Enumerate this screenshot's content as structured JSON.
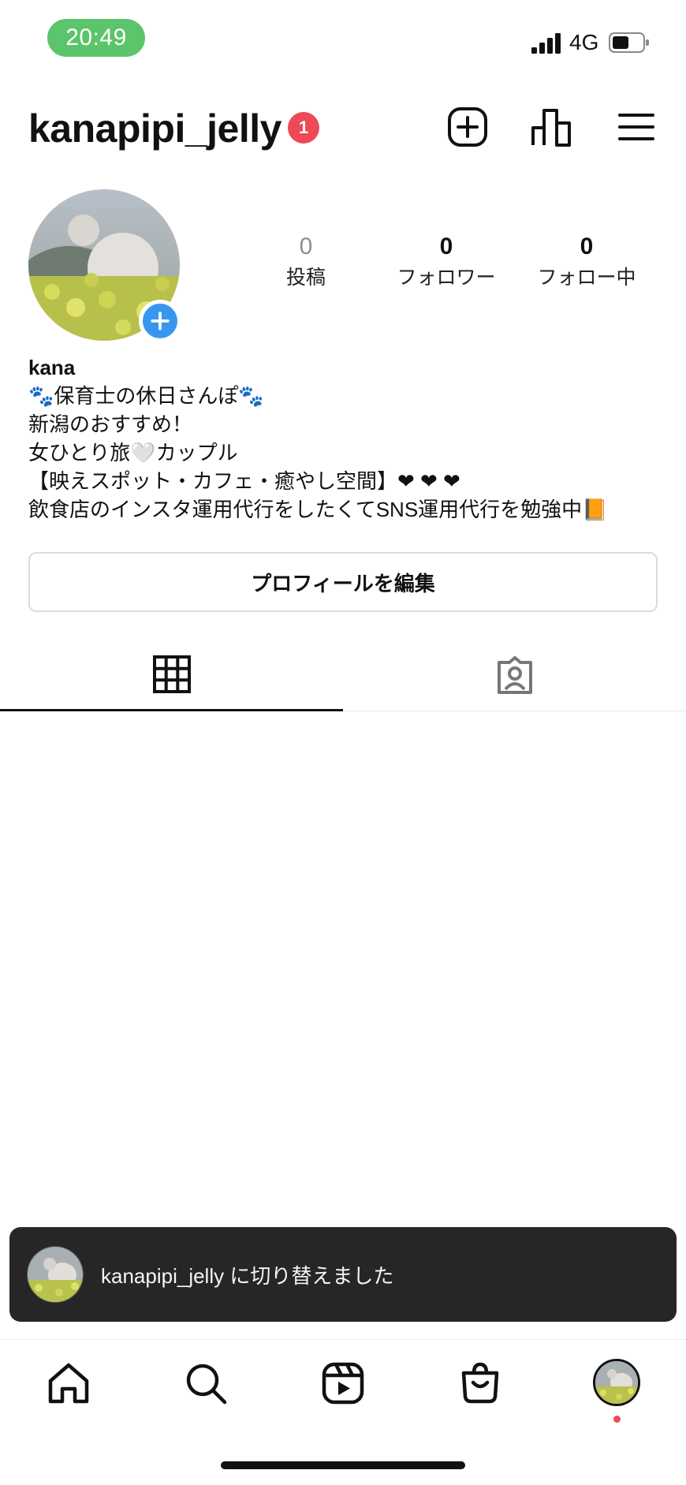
{
  "status_bar": {
    "time": "20:49",
    "network": "4G"
  },
  "header": {
    "username": "kanapipi_jelly",
    "notification_count": "1",
    "icons": [
      "new-post-icon",
      "insights-icon",
      "menu-icon"
    ]
  },
  "profile": {
    "stats": [
      {
        "value": "0",
        "label": "投稿"
      },
      {
        "value": "0",
        "label": "フォロワー"
      },
      {
        "value": "0",
        "label": "フォロー中"
      }
    ],
    "name": "kana",
    "bio_lines": [
      "🐾保育士の休日さんぽ🐾",
      "新潟のおすすめ！",
      "女ひとり旅🤍カップル",
      "【映えスポット・カフェ・癒やし空間】❤︎ ❤︎ ❤︎",
      "飲食店のインスタ運用代行をしたくてSNS運用代行を勉強中📙"
    ],
    "edit_button_label": "プロフィールを編集"
  },
  "tabs": [
    {
      "name": "grid",
      "icon": "grid-icon",
      "active": true
    },
    {
      "name": "tagged",
      "icon": "tagged-person-icon",
      "active": false
    }
  ],
  "toast": {
    "text": "kanapipi_jelly に切り替えました"
  },
  "bottom_nav": [
    "home-icon",
    "search-icon",
    "reels-icon",
    "shop-icon",
    "profile-avatar"
  ],
  "colors": {
    "accent_blue": "#3797f0",
    "badge_red": "#ed4956",
    "time_pill_green": "#5cc46a",
    "toast_bg": "#262626"
  }
}
